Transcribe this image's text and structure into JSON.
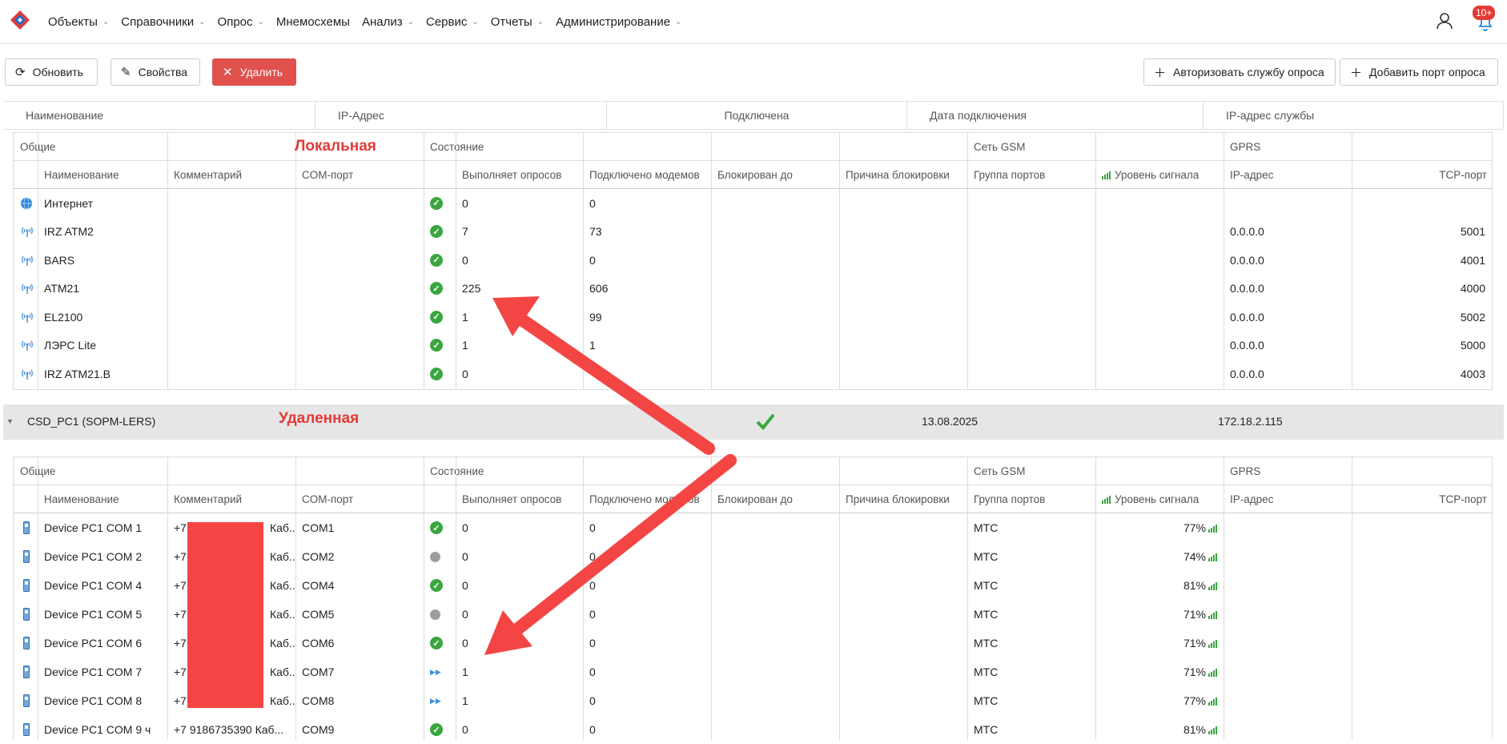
{
  "nav": {
    "items": [
      {
        "label": "Объекты",
        "dropdown": true
      },
      {
        "label": "Справочники",
        "dropdown": true
      },
      {
        "label": "Опрос",
        "dropdown": true
      },
      {
        "label": "Мнемосхемы",
        "dropdown": false
      },
      {
        "label": "Анализ",
        "dropdown": true
      },
      {
        "label": "Сервис",
        "dropdown": true
      },
      {
        "label": "Отчеты",
        "dropdown": true
      },
      {
        "label": "Администрирование",
        "dropdown": true
      }
    ],
    "notifications_badge": "10+"
  },
  "toolbar": {
    "refresh": "Обновить",
    "properties": "Свойства",
    "delete": "Удалить",
    "authorize": "Авторизовать службу опроса",
    "add_port": "Добавить порт опроса"
  },
  "outer_columns": [
    "Наименование",
    "IP-Адрес",
    "Подключена",
    "Дата подключения",
    "IP-адрес службы"
  ],
  "sub_header": {
    "groups": {
      "general": "Общие",
      "state": "Состояние",
      "gsm": "Сеть GSM",
      "gprs": "GPRS"
    },
    "columns": {
      "name": "Наименование",
      "comment": "Комментарий",
      "com": "COM-порт",
      "polls": "Выполняет опросов",
      "modems": "Подключено модемов",
      "blocked_until": "Блокирован до",
      "block_reason": "Причина блокировки",
      "port_group": "Группа портов",
      "signal": "Уровень сигнала",
      "ip": "IP-адрес",
      "tcp": "TCP-порт"
    }
  },
  "annotations": {
    "local": "Локальная",
    "remote": "Удаленная"
  },
  "local_rows": [
    {
      "icon": "globe-icon",
      "name": "Интернет",
      "polls": "0",
      "modems": "0",
      "ip": "",
      "tcp": ""
    },
    {
      "icon": "antenna-icon",
      "name": "IRZ ATM2",
      "polls": "7",
      "modems": "73",
      "ip": "0.0.0.0",
      "tcp": "5001"
    },
    {
      "icon": "antenna-icon",
      "name": "BARS",
      "polls": "0",
      "modems": "0",
      "ip": "0.0.0.0",
      "tcp": "4001"
    },
    {
      "icon": "antenna-icon",
      "name": "ATM21",
      "polls": "225",
      "modems": "606",
      "ip": "0.0.0.0",
      "tcp": "4000"
    },
    {
      "icon": "antenna-icon",
      "name": "EL2100",
      "polls": "1",
      "modems": "99",
      "ip": "0.0.0.0",
      "tcp": "5002"
    },
    {
      "icon": "antenna-icon",
      "name": "ЛЭРС Lite",
      "polls": "1",
      "modems": "1",
      "ip": "0.0.0.0",
      "tcp": "5000"
    },
    {
      "icon": "antenna-icon",
      "name": "IRZ ATM21.B",
      "polls": "0",
      "modems": "",
      "ip": "0.0.0.0",
      "tcp": "4003"
    }
  ],
  "group": {
    "name": "CSD_PC1 (SOPM-LERS)",
    "date": "13.08.2025",
    "service_ip": "172.18.2.115"
  },
  "remote_rows": [
    {
      "name": "Device PC1 COM 1",
      "comment": "+7",
      "comment_tail": "Каб...",
      "com": "COM1",
      "state": "ok",
      "polls": "0",
      "modems": "0",
      "group": "МТС",
      "signal": "77%"
    },
    {
      "name": "Device PC1 COM 2",
      "comment": "+7",
      "comment_tail": "Каб...",
      "com": "COM2",
      "state": "idle",
      "polls": "0",
      "modems": "0",
      "group": "МТС",
      "signal": "74%"
    },
    {
      "name": "Device PC1 COM 4",
      "comment": "+7",
      "comment_tail": "Каб...",
      "com": "COM4",
      "state": "ok",
      "polls": "0",
      "modems": "0",
      "group": "МТС",
      "signal": "81%"
    },
    {
      "name": "Device PC1 COM 5",
      "comment": "+7",
      "comment_tail": "Каб...",
      "com": "COM5",
      "state": "idle",
      "polls": "0",
      "modems": "0",
      "group": "МТС",
      "signal": "71%"
    },
    {
      "name": "Device PC1 COM 6",
      "comment": "+7",
      "comment_tail": "Каб...",
      "com": "COM6",
      "state": "ok",
      "polls": "0",
      "modems": "0",
      "group": "МТС",
      "signal": "71%"
    },
    {
      "name": "Device PC1 COM 7",
      "comment": "+7",
      "comment_tail": "Каб...",
      "com": "COM7",
      "state": "play",
      "polls": "1",
      "modems": "0",
      "group": "МТС",
      "signal": "71%"
    },
    {
      "name": "Device PC1 COM 8",
      "comment": "+7",
      "comment_tail": "Каб...",
      "com": "COM8",
      "state": "play",
      "polls": "1",
      "modems": "0",
      "group": "МТС",
      "signal": "77%"
    },
    {
      "name": "Device PC1 COM 9 ч",
      "comment": "+7 9186735390 Каб...",
      "comment_tail": "",
      "com": "COM9",
      "state": "ok",
      "polls": "0",
      "modems": "0",
      "group": "МТС",
      "signal": "81%"
    }
  ],
  "colors": {
    "accent_red": "#e0504c",
    "ok_green": "#3aa640",
    "arrow_red": "#f44545"
  }
}
